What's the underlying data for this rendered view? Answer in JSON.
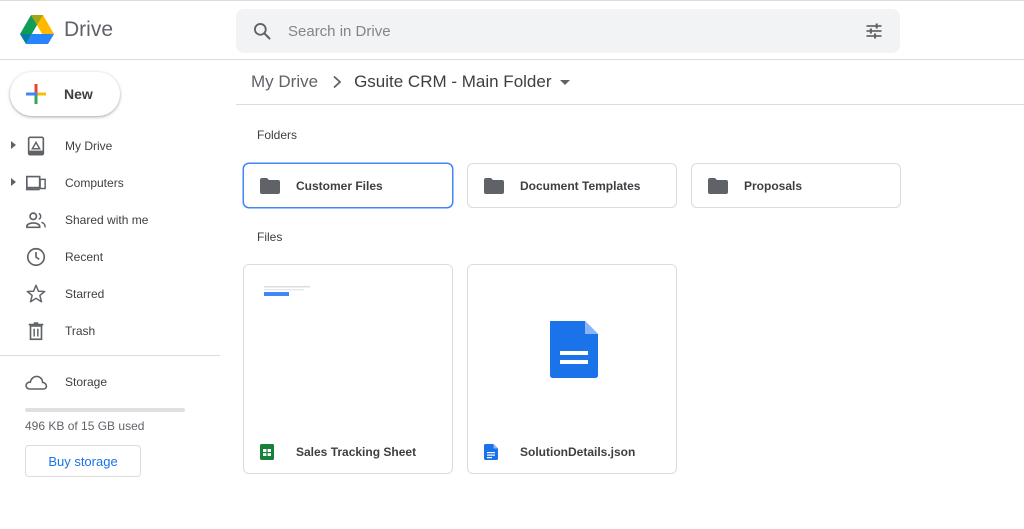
{
  "header": {
    "app_name": "Drive",
    "search_placeholder": "Search in Drive"
  },
  "sidebar": {
    "new_label": "New",
    "items": [
      {
        "label": "My Drive",
        "icon": "my-drive-icon",
        "expandable": true
      },
      {
        "label": "Computers",
        "icon": "computers-icon",
        "expandable": true
      },
      {
        "label": "Shared with me",
        "icon": "shared-with-me-icon",
        "expandable": false
      },
      {
        "label": "Recent",
        "icon": "recent-clock-icon",
        "expandable": false
      },
      {
        "label": "Starred",
        "icon": "star-icon",
        "expandable": false
      },
      {
        "label": "Trash",
        "icon": "trash-icon",
        "expandable": false
      }
    ],
    "storage": {
      "label": "Storage",
      "used_text": "496 KB of 15 GB used",
      "used_fraction": 0.0,
      "buy_label": "Buy storage"
    }
  },
  "breadcrumb": {
    "root": "My Drive",
    "current": "Gsuite CRM - Main Folder"
  },
  "main": {
    "folders_title": "Folders",
    "folders": [
      {
        "name": "Customer Files",
        "selected": true
      },
      {
        "name": "Document Templates",
        "selected": false
      },
      {
        "name": "Proposals",
        "selected": false
      }
    ],
    "files_title": "Files",
    "files": [
      {
        "name": "Sales Tracking Sheet",
        "type": "sheets"
      },
      {
        "name": "SolutionDetails.json",
        "type": "docs"
      }
    ]
  },
  "colors": {
    "accent": "#1a73e8",
    "folder_icon": "#5f6368",
    "sheets_green": "#188038",
    "docs_blue": "#1a73e8",
    "selected_border": "#4285f4"
  }
}
